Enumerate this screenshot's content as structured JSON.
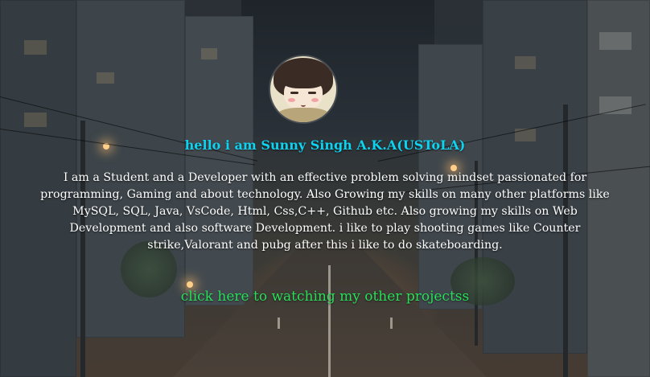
{
  "profile": {
    "avatar_alt": "profile avatar",
    "headline": "hello i am Sunny Singh A.K.A(USToLA)",
    "bio": "I am a Student and a Developer with an effective problem solving mindset passionated for programming, Gaming and about technology. Also Growing my skills on many other platforms like MySQL, SQL, Java, VsCode, Html, Css,C++, Github etc. Also growing my skills on Web Development and also software Development. i like to play shooting games like Counter strike,Valorant and pubg after this i like to do skateboarding."
  },
  "links": {
    "projects_label": "click here to watching my other projectss"
  },
  "colors": {
    "headline": "#0fd2f0",
    "link": "#27e05a",
    "bio": "#ffffff"
  }
}
